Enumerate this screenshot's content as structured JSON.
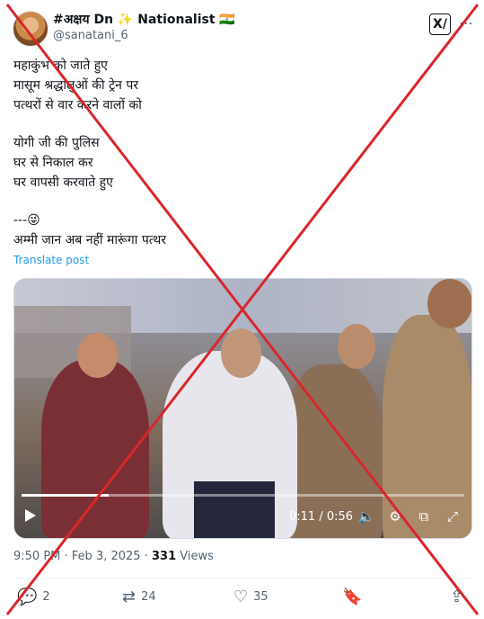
{
  "author": {
    "display_name": "#अक्षय Dn ✨ Nationalist 🇮🇳",
    "handle": "@sanatani_6"
  },
  "tweet": {
    "lines_1": [
      "महाकुंभ को जाते हुए",
      "मासूम श्रद्धालुओं की ट्रेन पर",
      "पत्थरों से वार करने वालों को"
    ],
    "lines_2": [
      "योगी जी की पुलिस",
      "घर से निकाल कर",
      "घर वापसी करवाते हुए"
    ],
    "lines_3": [
      "---😜",
      "अम्मी जान अब नहीं मारूंगा पत्थर"
    ],
    "translate_label": "Translate post"
  },
  "video": {
    "time_label": "0:11 / 0:56",
    "progress": 0.196,
    "icons": [
      "play-icon",
      "volume-icon",
      "settings-icon",
      "dock-icon",
      "fullscreen-icon"
    ]
  },
  "meta": {
    "time": "9:50 PM",
    "separator": " · ",
    "date": "Feb 3, 2025",
    "views_count": "331",
    "views_label": "Views"
  },
  "actions": {
    "replies": "2",
    "reposts": "24",
    "likes": "35"
  },
  "colors": {
    "cross": "#d9262b",
    "link": "#1d9bf0",
    "muted": "#536471"
  }
}
